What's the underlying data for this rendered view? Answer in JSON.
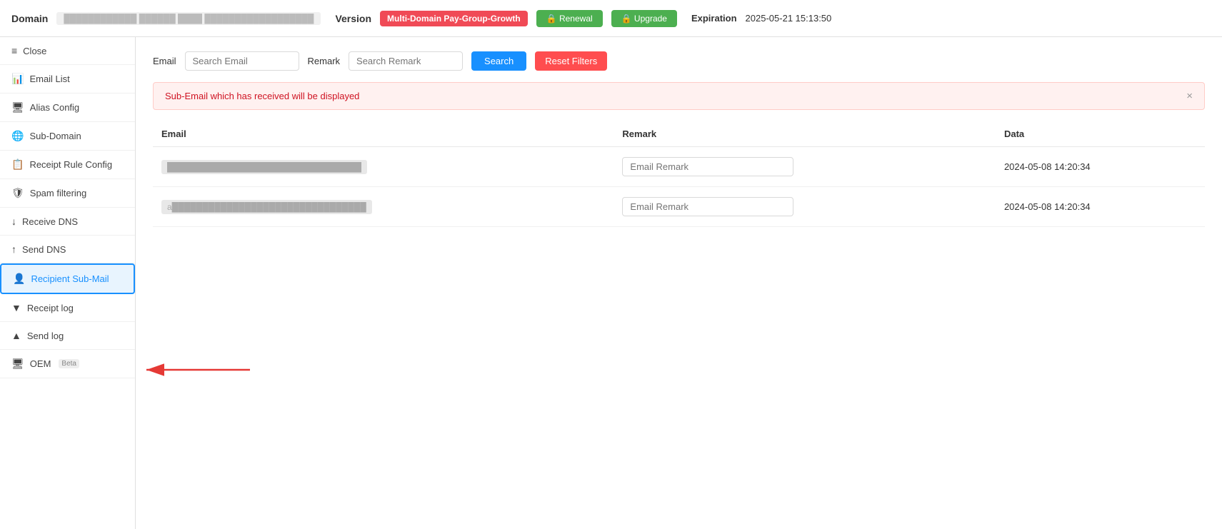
{
  "topbar": {
    "domain_label": "Domain",
    "domain_value": "██████████████████████████████████████",
    "version_label": "Version",
    "version_badge": "Multi-Domain Pay-Group-Growth",
    "renewal_btn": "🔒 Renewal",
    "upgrade_btn": "🔒 Upgrade",
    "expiration_label": "Expiration",
    "expiration_value": "2025-05-21 15:13:50"
  },
  "sidebar": {
    "items": [
      {
        "id": "close",
        "icon": "≡",
        "label": "Close"
      },
      {
        "id": "email-list",
        "icon": "📊",
        "label": "Email List"
      },
      {
        "id": "alias-config",
        "icon": "🖥",
        "label": "Alias Config"
      },
      {
        "id": "sub-domain",
        "icon": "🌐",
        "label": "Sub-Domain"
      },
      {
        "id": "receipt-rule-config",
        "icon": "📋",
        "label": "Receipt Rule Config"
      },
      {
        "id": "spam-filtering",
        "icon": "🛡",
        "label": "Spam filtering"
      },
      {
        "id": "receive-dns",
        "icon": "↓",
        "label": "Receive DNS"
      },
      {
        "id": "send-dns",
        "icon": "↑",
        "label": "Send DNS"
      },
      {
        "id": "recipient-sub-mail",
        "icon": "👤",
        "label": "Recipient Sub-Mail",
        "active": true
      },
      {
        "id": "receipt-log",
        "icon": "▼",
        "label": "Receipt log"
      },
      {
        "id": "send-log",
        "icon": "▲",
        "label": "Send log"
      },
      {
        "id": "oem",
        "icon": "🖥",
        "label": "OEM",
        "beta": true
      }
    ]
  },
  "content": {
    "filter": {
      "email_label": "Email",
      "email_placeholder": "Search Email",
      "remark_label": "Remark",
      "remark_placeholder": "Search Remark",
      "search_btn": "Search",
      "reset_btn": "Reset Filters"
    },
    "notice": {
      "text": "Sub-Email which has received will be displayed",
      "close_btn": "×"
    },
    "table": {
      "headers": [
        "Email",
        "Remark",
        "Data"
      ],
      "rows": [
        {
          "email": "████████████████████████████",
          "remark_placeholder": "Email Remark",
          "data": "2024-05-08 14:20:34"
        },
        {
          "email": "a███████████████████████████",
          "remark_placeholder": "Email Remark",
          "data": "2024-05-08 14:20:34"
        }
      ]
    }
  }
}
